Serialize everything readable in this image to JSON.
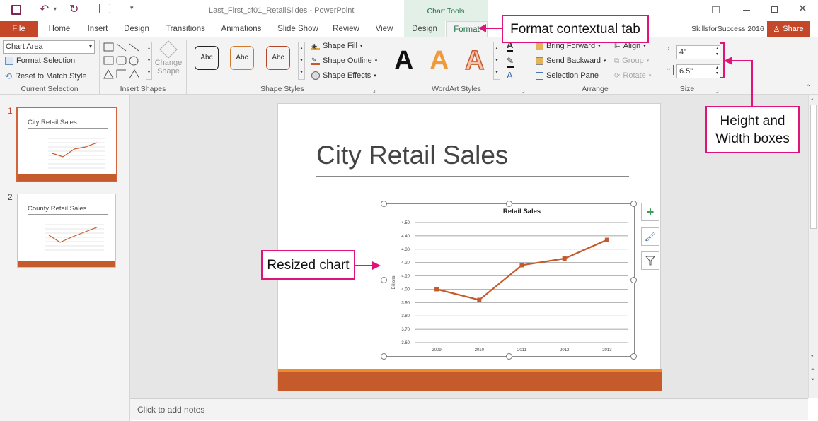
{
  "titlebar": {
    "doc_title": "Last_First_cf01_RetailSlides - PowerPoint",
    "contextual_group": "Chart Tools"
  },
  "tabs": {
    "file": "File",
    "items": [
      "Home",
      "Insert",
      "Design",
      "Transitions",
      "Animations",
      "Slide Show",
      "Review",
      "View",
      "Design",
      "Format"
    ],
    "account": "SkillsforSuccess 2016",
    "share": "Share"
  },
  "ribbon": {
    "current_selection": {
      "dropdown_value": "Chart Area",
      "format_selection": "Format Selection",
      "reset_style": "Reset to Match Style",
      "label": "Current Selection"
    },
    "insert_shapes": {
      "label": "Insert Shapes",
      "change_shape_line1": "Change",
      "change_shape_line2": "Shape"
    },
    "shape_styles": {
      "presets": [
        "Abc",
        "Abc",
        "Abc"
      ],
      "fill": "Shape Fill",
      "outline": "Shape Outline",
      "effects": "Shape Effects",
      "label": "Shape Styles"
    },
    "wordart": {
      "letters": [
        "A",
        "A",
        "A"
      ],
      "label": "WordArt Styles"
    },
    "arrange": {
      "bring_forward": "Bring Forward",
      "send_backward": "Send Backward",
      "selection_pane": "Selection Pane",
      "align": "Align",
      "group": "Group",
      "rotate": "Rotate",
      "label": "Arrange"
    },
    "size": {
      "height": "4\"",
      "width": "6.5\"",
      "label": "Size"
    }
  },
  "callouts": {
    "format_tab": "Format contextual tab",
    "size_boxes_line1": "Height and",
    "size_boxes_line2": "Width boxes",
    "resized_chart": "Resized chart"
  },
  "thumbnails": [
    {
      "number": "1",
      "title": "City Retail Sales"
    },
    {
      "number": "2",
      "title": "County Retail Sales"
    }
  ],
  "slide": {
    "title": "City Retail Sales"
  },
  "notes": {
    "placeholder": "Click to add notes"
  },
  "colors": {
    "accent": "#b7472a",
    "callout": "#e0137b",
    "slide_band": "#c55a2a",
    "line": "#c55a2a"
  },
  "chart_data": {
    "type": "line",
    "title": "Retail Sales",
    "ylabel": "Billions",
    "categories": [
      "2009",
      "2010",
      "2011",
      "2012",
      "2013"
    ],
    "values": [
      4.0,
      3.92,
      4.18,
      4.23,
      4.37
    ],
    "ylim": [
      3.6,
      4.5
    ],
    "yticks": [
      "4.50",
      "4.40",
      "4.30",
      "4.20",
      "4.10",
      "4.00",
      "3.90",
      "3.80",
      "3.70",
      "3.60"
    ],
    "grid": true
  }
}
